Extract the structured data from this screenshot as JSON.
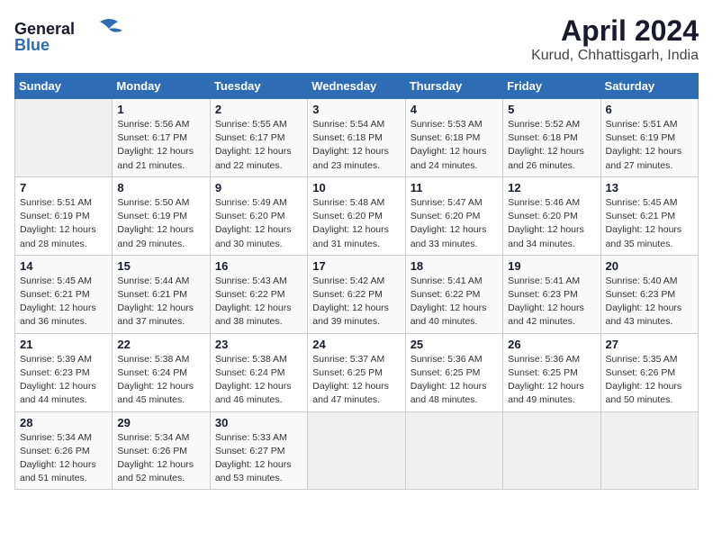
{
  "logo": {
    "line1": "General",
    "line2": "Blue"
  },
  "title": "April 2024",
  "subtitle": "Kurud, Chhattisgarh, India",
  "days_header": [
    "Sunday",
    "Monday",
    "Tuesday",
    "Wednesday",
    "Thursday",
    "Friday",
    "Saturday"
  ],
  "weeks": [
    [
      {
        "num": "",
        "info": ""
      },
      {
        "num": "1",
        "info": "Sunrise: 5:56 AM\nSunset: 6:17 PM\nDaylight: 12 hours\nand 21 minutes."
      },
      {
        "num": "2",
        "info": "Sunrise: 5:55 AM\nSunset: 6:17 PM\nDaylight: 12 hours\nand 22 minutes."
      },
      {
        "num": "3",
        "info": "Sunrise: 5:54 AM\nSunset: 6:18 PM\nDaylight: 12 hours\nand 23 minutes."
      },
      {
        "num": "4",
        "info": "Sunrise: 5:53 AM\nSunset: 6:18 PM\nDaylight: 12 hours\nand 24 minutes."
      },
      {
        "num": "5",
        "info": "Sunrise: 5:52 AM\nSunset: 6:18 PM\nDaylight: 12 hours\nand 26 minutes."
      },
      {
        "num": "6",
        "info": "Sunrise: 5:51 AM\nSunset: 6:19 PM\nDaylight: 12 hours\nand 27 minutes."
      }
    ],
    [
      {
        "num": "7",
        "info": "Sunrise: 5:51 AM\nSunset: 6:19 PM\nDaylight: 12 hours\nand 28 minutes."
      },
      {
        "num": "8",
        "info": "Sunrise: 5:50 AM\nSunset: 6:19 PM\nDaylight: 12 hours\nand 29 minutes."
      },
      {
        "num": "9",
        "info": "Sunrise: 5:49 AM\nSunset: 6:20 PM\nDaylight: 12 hours\nand 30 minutes."
      },
      {
        "num": "10",
        "info": "Sunrise: 5:48 AM\nSunset: 6:20 PM\nDaylight: 12 hours\nand 31 minutes."
      },
      {
        "num": "11",
        "info": "Sunrise: 5:47 AM\nSunset: 6:20 PM\nDaylight: 12 hours\nand 33 minutes."
      },
      {
        "num": "12",
        "info": "Sunrise: 5:46 AM\nSunset: 6:20 PM\nDaylight: 12 hours\nand 34 minutes."
      },
      {
        "num": "13",
        "info": "Sunrise: 5:45 AM\nSunset: 6:21 PM\nDaylight: 12 hours\nand 35 minutes."
      }
    ],
    [
      {
        "num": "14",
        "info": "Sunrise: 5:45 AM\nSunset: 6:21 PM\nDaylight: 12 hours\nand 36 minutes."
      },
      {
        "num": "15",
        "info": "Sunrise: 5:44 AM\nSunset: 6:21 PM\nDaylight: 12 hours\nand 37 minutes."
      },
      {
        "num": "16",
        "info": "Sunrise: 5:43 AM\nSunset: 6:22 PM\nDaylight: 12 hours\nand 38 minutes."
      },
      {
        "num": "17",
        "info": "Sunrise: 5:42 AM\nSunset: 6:22 PM\nDaylight: 12 hours\nand 39 minutes."
      },
      {
        "num": "18",
        "info": "Sunrise: 5:41 AM\nSunset: 6:22 PM\nDaylight: 12 hours\nand 40 minutes."
      },
      {
        "num": "19",
        "info": "Sunrise: 5:41 AM\nSunset: 6:23 PM\nDaylight: 12 hours\nand 42 minutes."
      },
      {
        "num": "20",
        "info": "Sunrise: 5:40 AM\nSunset: 6:23 PM\nDaylight: 12 hours\nand 43 minutes."
      }
    ],
    [
      {
        "num": "21",
        "info": "Sunrise: 5:39 AM\nSunset: 6:23 PM\nDaylight: 12 hours\nand 44 minutes."
      },
      {
        "num": "22",
        "info": "Sunrise: 5:38 AM\nSunset: 6:24 PM\nDaylight: 12 hours\nand 45 minutes."
      },
      {
        "num": "23",
        "info": "Sunrise: 5:38 AM\nSunset: 6:24 PM\nDaylight: 12 hours\nand 46 minutes."
      },
      {
        "num": "24",
        "info": "Sunrise: 5:37 AM\nSunset: 6:25 PM\nDaylight: 12 hours\nand 47 minutes."
      },
      {
        "num": "25",
        "info": "Sunrise: 5:36 AM\nSunset: 6:25 PM\nDaylight: 12 hours\nand 48 minutes."
      },
      {
        "num": "26",
        "info": "Sunrise: 5:36 AM\nSunset: 6:25 PM\nDaylight: 12 hours\nand 49 minutes."
      },
      {
        "num": "27",
        "info": "Sunrise: 5:35 AM\nSunset: 6:26 PM\nDaylight: 12 hours\nand 50 minutes."
      }
    ],
    [
      {
        "num": "28",
        "info": "Sunrise: 5:34 AM\nSunset: 6:26 PM\nDaylight: 12 hours\nand 51 minutes."
      },
      {
        "num": "29",
        "info": "Sunrise: 5:34 AM\nSunset: 6:26 PM\nDaylight: 12 hours\nand 52 minutes."
      },
      {
        "num": "30",
        "info": "Sunrise: 5:33 AM\nSunset: 6:27 PM\nDaylight: 12 hours\nand 53 minutes."
      },
      {
        "num": "",
        "info": ""
      },
      {
        "num": "",
        "info": ""
      },
      {
        "num": "",
        "info": ""
      },
      {
        "num": "",
        "info": ""
      }
    ]
  ]
}
